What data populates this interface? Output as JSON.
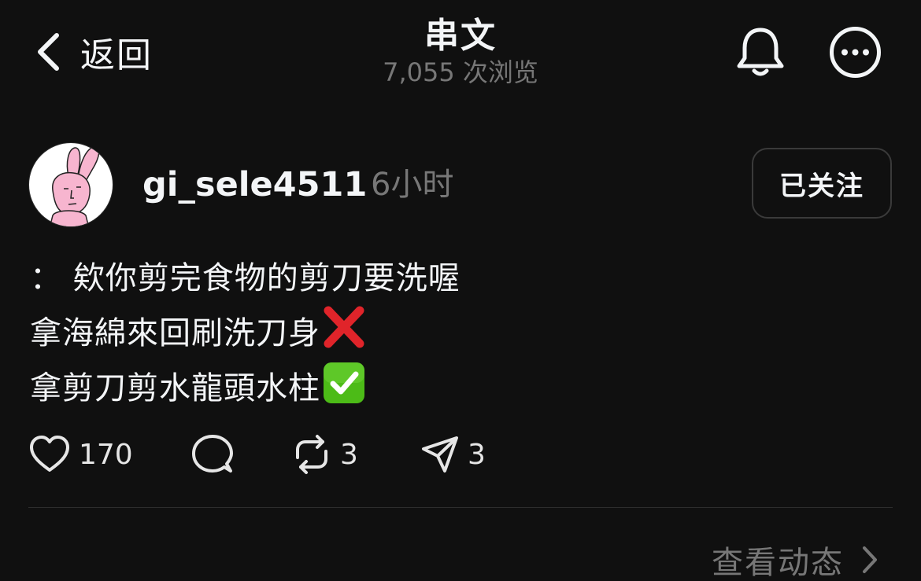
{
  "header": {
    "back_label": "返回",
    "title": "串文",
    "views": "7,055 次浏览"
  },
  "post": {
    "username": "gi_sele4511",
    "time": "6小时",
    "follow_label": "已关注",
    "lines": [
      "：  欸你剪完食物的剪刀要洗喔",
      "拿海綿來回刷洗刀身",
      "拿剪刀剪水龍頭水柱"
    ],
    "emojis": [
      "cross-mark",
      "check-mark-button"
    ],
    "likes": "170",
    "reposts": "3",
    "shares": "3"
  },
  "footer": {
    "activity_label": "查看动态"
  },
  "colors": {
    "background": "#101010",
    "text": "#f3f5f7",
    "secondary": "#777777",
    "divider": "#2d2d2d",
    "avatar_pink": "#f7b5cf"
  },
  "icons": [
    "chevron-left-icon",
    "bell-icon",
    "more-icon",
    "heart-icon",
    "comment-icon",
    "repost-icon",
    "send-icon",
    "chevron-right-icon"
  ]
}
